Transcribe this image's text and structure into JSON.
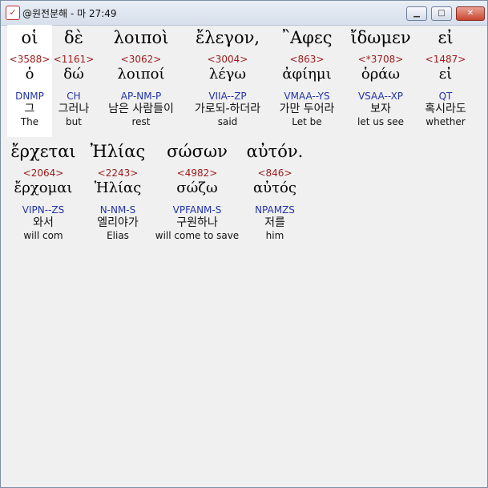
{
  "window": {
    "title": "@원전분해 - 마 27:49",
    "app_icon": "app-icon",
    "controls": [
      "minimize-icon",
      "maximize-icon",
      "close-icon"
    ]
  },
  "rows": [
    {
      "words": [
        {
          "greek": "οἱ",
          "strong": "<3588>",
          "lemma": "ὁ",
          "morph": "DNMP",
          "korean": "그",
          "english": "The"
        },
        {
          "greek": "δὲ",
          "strong": "<1161>",
          "lemma": "δώ",
          "morph": "CH",
          "korean": "그러나",
          "english": "but"
        },
        {
          "greek": "λοιποὶ",
          "strong": "<3062>",
          "lemma": "λοιποί",
          "morph": "AP-NM-P",
          "korean": "남은 사람들이",
          "english": "rest"
        },
        {
          "greek": "ἔλεγον,",
          "strong": "<3004>",
          "lemma": "λέγω",
          "morph": "VIIA--ZP",
          "korean": "가로되-하더라",
          "english": "said"
        },
        {
          "greek": "῍Αφες",
          "strong": "<863>",
          "lemma": "ἀφίημι",
          "morph": "VMAA--YS",
          "korean": "가만 두어라",
          "english": "Let be"
        },
        {
          "greek": "ἴδωμεν",
          "strong": "<*3708>",
          "lemma": "ὁράω",
          "morph": "VSAA--XP",
          "korean": "보자",
          "english": "let us see"
        },
        {
          "greek": "εἰ",
          "strong": "<1487>",
          "lemma": "εἰ",
          "morph": "QT",
          "korean": "혹시라도",
          "english": "whether"
        }
      ]
    },
    {
      "words": [
        {
          "greek": "ἔρχεται",
          "strong": "<2064>",
          "lemma": "ἔρχομαι",
          "morph": "VIPN--ZS",
          "korean": "와서",
          "english": "will com"
        },
        {
          "greek": "Ἠλίας",
          "strong": "<2243>",
          "lemma": "Ἡλίας",
          "morph": "N-NM-S",
          "korean": "엘리야가",
          "english": "Elias"
        },
        {
          "greek": "σώσων",
          "strong": "<4982>",
          "lemma": "σώζω",
          "morph": "VPFANM-S",
          "korean": "구원하나",
          "english": "will come to save"
        },
        {
          "greek": "αὐτόν.",
          "strong": "<846>",
          "lemma": "αὐτός",
          "morph": "NPAMZS",
          "korean": "저를",
          "english": "him"
        }
      ]
    }
  ]
}
